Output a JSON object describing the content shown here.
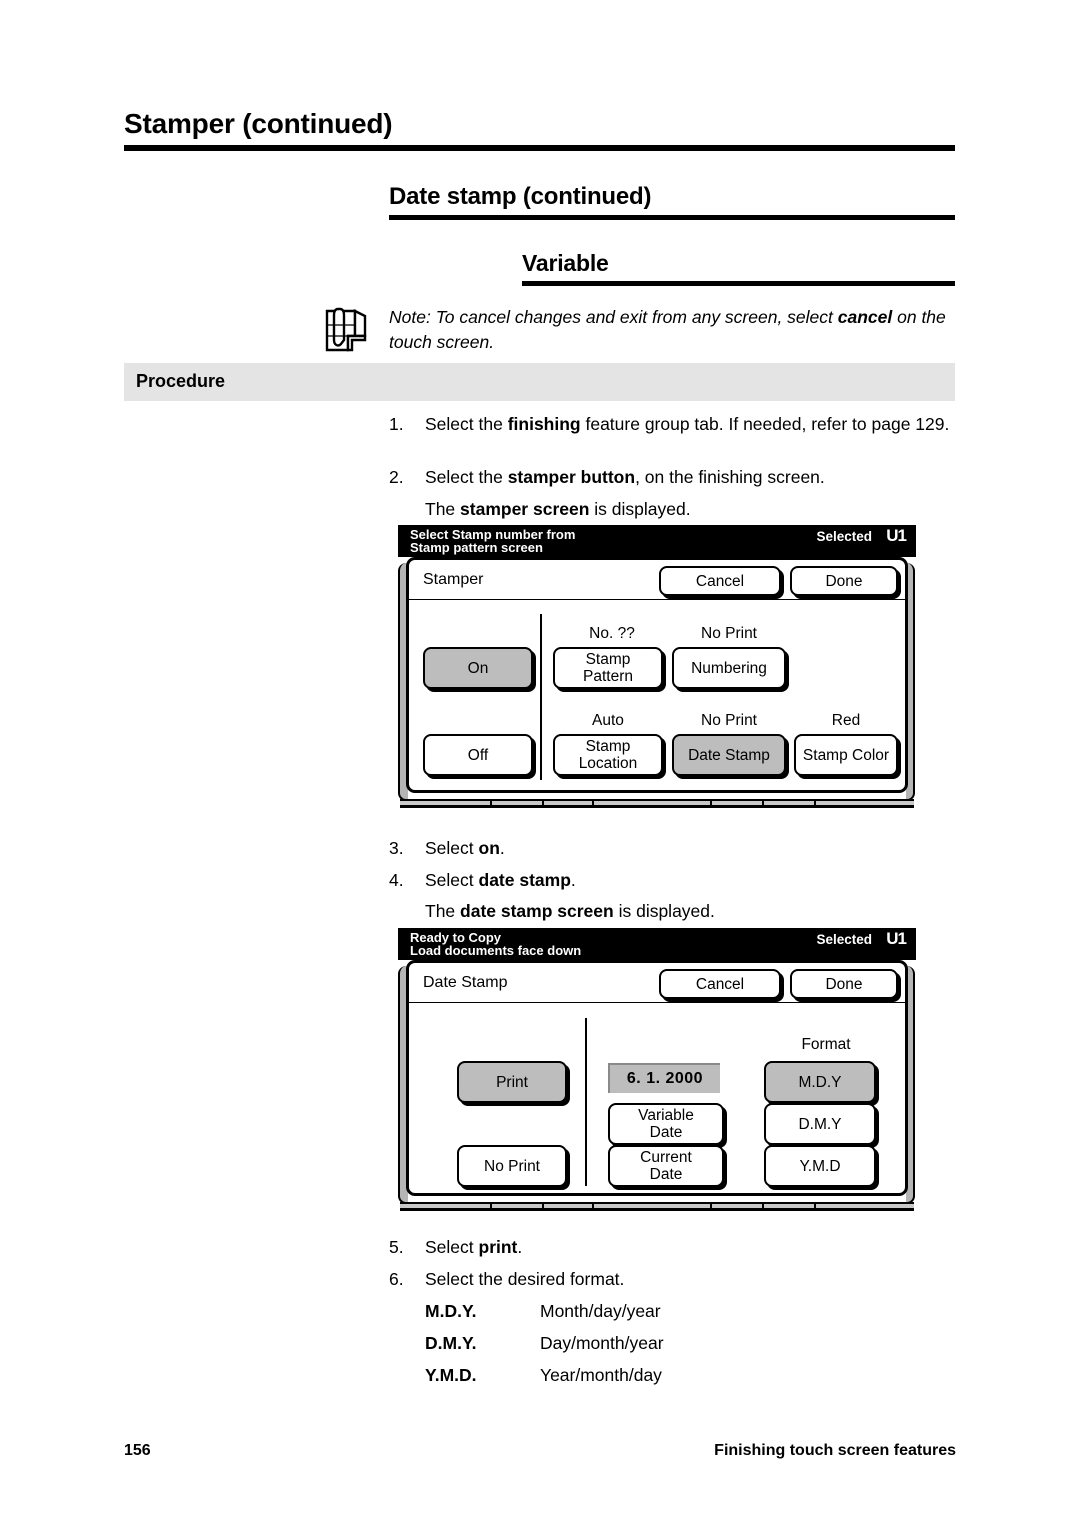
{
  "document": {
    "heading1": "Stamper (continued)",
    "heading2": "Date stamp (continued)",
    "heading3": "Variable",
    "note": {
      "icon": "note-document-icon",
      "prefix": "Note:  To cancel changes and exit from any screen, select ",
      "emphasis": "cancel",
      "suffix": " on the touch screen."
    },
    "procedure_label": "Procedure"
  },
  "steps": [
    {
      "num": "1.",
      "pre": "Select the ",
      "bold": "finishing",
      "post": " feature group tab.  If needed, refer to page 129."
    },
    {
      "num": "2.",
      "pre": "Select the ",
      "bold": "stamper button",
      "post": ", on the finishing screen."
    },
    {
      "num": "3.",
      "pre": "Select ",
      "bold": "on",
      "post": "."
    },
    {
      "num": "4.",
      "pre": "Select ",
      "bold": "date stamp",
      "post": "."
    },
    {
      "num": "5.",
      "pre": "Select ",
      "bold": "print",
      "post": "."
    },
    {
      "num": "6.",
      "pre": "Select the desired format.",
      "bold": "",
      "post": ""
    }
  ],
  "result_lines": {
    "stamper_screen": {
      "pre": "The ",
      "bold": "stamper screen",
      "post": " is displayed."
    },
    "date_stamp_screen": {
      "pre": "The ",
      "bold": "date stamp screen",
      "post": " is displayed."
    }
  },
  "format_table": [
    {
      "code": "M.D.Y.",
      "desc": "Month/day/year"
    },
    {
      "code": "D.M.Y.",
      "desc": "Day/month/year"
    },
    {
      "code": "Y.M.D.",
      "desc": "Year/month/day"
    }
  ],
  "stamper_screen": {
    "status_line1": "Select Stamp number from",
    "status_line2": "Stamp pattern screen",
    "status_selected_label": "Selected",
    "status_selected_value": "U1",
    "title": "Stamper",
    "cancel_label": "Cancel",
    "done_label": "Done",
    "on_label": "On",
    "off_label": "Off",
    "stamp_pattern_value": "No. ??",
    "stamp_pattern_line1": "Stamp",
    "stamp_pattern_line2": "Pattern",
    "numbering_value": "No Print",
    "numbering_label": "Numbering",
    "stamp_location_value": "Auto",
    "stamp_location_line1": "Stamp",
    "stamp_location_line2": "Location",
    "date_stamp_value": "No Print",
    "date_stamp_label": "Date Stamp",
    "stamp_color_value": "Red",
    "stamp_color_label": "Stamp Color"
  },
  "date_stamp_screen": {
    "status_line1": "Ready to Copy",
    "status_line2": "Load documents face down",
    "status_selected_label": "Selected",
    "status_selected_value": "U1",
    "title": "Date Stamp",
    "cancel_label": "Cancel",
    "done_label": "Done",
    "print_label": "Print",
    "no_print_label": "No Print",
    "date_value": "6. 1.  2000",
    "variable_date_line1": "Variable",
    "variable_date_line2": "Date",
    "current_date_line1": "Current",
    "current_date_line2": "Date",
    "format_header": "Format",
    "format_mdy": "M.D.Y",
    "format_dmy": "D.M.Y",
    "format_ymd": "Y.M.D"
  },
  "footer": {
    "page_number": "156",
    "section": "Finishing touch screen features"
  },
  "colors": {
    "selected_button": "#bdbdbd",
    "procedure_bar": "#e4e4e4",
    "bezel_shadow": "#b5b5b5",
    "tab_strip": "#c8c8c8"
  }
}
